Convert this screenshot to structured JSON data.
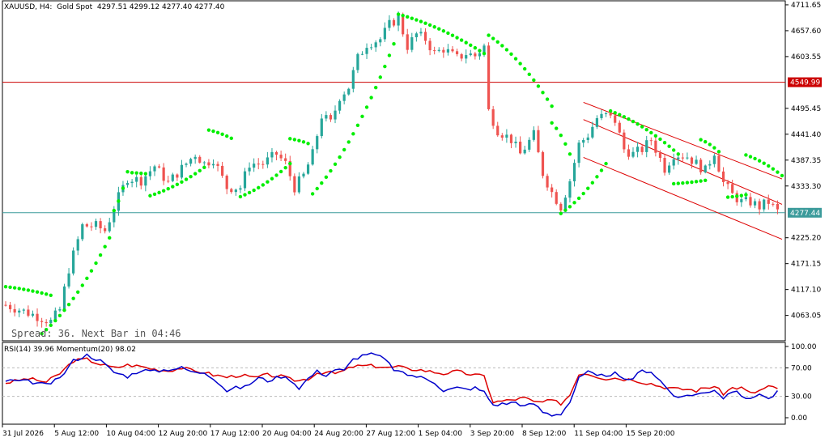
{
  "symbol_header": "XAUUSD, H4:  Gold Spot  4297.51 4299.12 4277.40 4277.40",
  "spread_text": "Spread: 36. Next Bar in 04:46",
  "indicator_header": "RSI(14) 39.96 Momentum(20) 98.02",
  "colors": {
    "bull": "#26a69a",
    "bear": "#ef5350",
    "sar": "#00ee00",
    "hline_red": "#cc0000",
    "hline_teal": "#3b9b9b",
    "rsi": "#0000cc",
    "momentum": "#dd0000",
    "channel": "#dd0000"
  },
  "chart_data": [
    {
      "type": "candlestick",
      "symbol": "XAUUSD",
      "timeframe": "H4",
      "ohlc_last": {
        "open": 4297.51,
        "high": 4299.12,
        "low": 4277.4,
        "close": 4277.4
      },
      "ylim": [
        4010,
        4720
      ],
      "price_ticks": [
        "4711.65",
        "4657.60",
        "4603.55",
        "4495.45",
        "4441.40",
        "4387.35",
        "4333.30",
        "4225.20",
        "4171.15",
        "4117.10",
        "4063.05"
      ],
      "horizontal_lines": [
        {
          "label": "4549.99",
          "value": 4549.99,
          "color": "#cc0000"
        },
        {
          "label": "4277.44",
          "value": 4277.44,
          "color": "#3b9b9b"
        }
      ],
      "time_labels": [
        "31 Jul 2026",
        "5 Aug 12:00",
        "10 Aug 04:00",
        "12 Aug 20:00",
        "17 Aug 12:00",
        "20 Aug 04:00",
        "24 Aug 20:00",
        "27 Aug 12:00",
        "1 Sep 04:00",
        "3 Sep 20:00",
        "8 Sep 12:00",
        "11 Sep 04:00",
        "15 Sep 20:00"
      ],
      "close_path": [
        [
          0,
          4085
        ],
        [
          6,
          4065
        ],
        [
          10,
          4050
        ],
        [
          12,
          4075
        ],
        [
          14,
          4160
        ],
        [
          17,
          4250
        ],
        [
          20,
          4250
        ],
        [
          22,
          4240
        ],
        [
          25,
          4310
        ],
        [
          27,
          4350
        ],
        [
          30,
          4345
        ],
        [
          33,
          4375
        ],
        [
          36,
          4340
        ],
        [
          39,
          4370
        ],
        [
          42,
          4400
        ],
        [
          44,
          4380
        ],
        [
          46,
          4390
        ],
        [
          49,
          4330
        ],
        [
          52,
          4330
        ],
        [
          54,
          4380
        ],
        [
          57,
          4380
        ],
        [
          60,
          4400
        ],
        [
          62,
          4380
        ],
        [
          64,
          4330
        ],
        [
          66,
          4355
        ],
        [
          68,
          4400
        ],
        [
          70,
          4480
        ],
        [
          72,
          4465
        ],
        [
          74,
          4520
        ],
        [
          76,
          4540
        ],
        [
          78,
          4600
        ],
        [
          80,
          4630
        ],
        [
          83,
          4640
        ],
        [
          85,
          4670
        ],
        [
          87,
          4685
        ],
        [
          89,
          4625
        ],
        [
          91,
          4650
        ],
        [
          93,
          4640
        ],
        [
          95,
          4610
        ],
        [
          97,
          4620
        ],
        [
          100,
          4600
        ],
        [
          102,
          4610
        ],
        [
          104,
          4605
        ],
        [
          106,
          4625
        ],
        [
          107,
          4490
        ],
        [
          109,
          4450
        ],
        [
          112,
          4430
        ],
        [
          114,
          4400
        ],
        [
          117,
          4440
        ],
        [
          119,
          4360
        ],
        [
          121,
          4320
        ],
        [
          123,
          4290
        ],
        [
          125,
          4345
        ],
        [
          127,
          4420
        ],
        [
          129,
          4440
        ],
        [
          131,
          4475
        ],
        [
          133,
          4480
        ],
        [
          135,
          4470
        ],
        [
          137,
          4410
        ],
        [
          139,
          4400
        ],
        [
          141,
          4410
        ],
        [
          143,
          4430
        ],
        [
          146,
          4370
        ],
        [
          148,
          4400
        ],
        [
          151,
          4395
        ],
        [
          153,
          4380
        ],
        [
          155,
          4365
        ],
        [
          157,
          4405
        ],
        [
          159,
          4340
        ],
        [
          161,
          4315
        ],
        [
          163,
          4300
        ],
        [
          165,
          4300
        ],
        [
          167,
          4290
        ],
        [
          169,
          4300
        ],
        [
          171,
          4280
        ]
      ],
      "parabolic_sar": [
        {
          "from": [
            0,
            4123
          ],
          "to": [
            10,
            4105
          ]
        },
        {
          "from": [
            8,
            4025
          ],
          "to": [
            23,
            4225
          ]
        },
        {
          "from": [
            24,
            4282
          ],
          "to": [
            27,
            4363
          ]
        },
        {
          "from": [
            28,
            4361
          ],
          "to": [
            31,
            4359
          ]
        },
        {
          "from": [
            32,
            4313
          ],
          "to": [
            44,
            4372
          ]
        },
        {
          "from": [
            45,
            4450
          ],
          "to": [
            50,
            4433
          ]
        },
        {
          "from": [
            52,
            4311
          ],
          "to": [
            63,
            4380
          ]
        },
        {
          "from": [
            63,
            4432
          ],
          "to": [
            67,
            4422
          ]
        },
        {
          "from": [
            68,
            4317
          ],
          "to": [
            86,
            4630
          ]
        },
        {
          "from": [
            87,
            4692
          ],
          "to": [
            106,
            4610
          ]
        },
        {
          "from": [
            107,
            4648
          ],
          "to": [
            121,
            4500
          ]
        },
        {
          "from": [
            121,
            4465
          ],
          "to": [
            125,
            4400
          ]
        },
        {
          "from": [
            123,
            4276
          ],
          "to": [
            133,
            4380
          ]
        },
        {
          "from": [
            134,
            4490
          ],
          "to": [
            149,
            4400
          ]
        },
        {
          "from": [
            148,
            4338
          ],
          "to": [
            155,
            4345
          ]
        },
        {
          "from": [
            154,
            4430
          ],
          "to": [
            158,
            4405
          ]
        },
        {
          "from": [
            160,
            4310
          ],
          "to": [
            164,
            4315
          ]
        },
        {
          "from": [
            164,
            4398
          ],
          "to": [
            172,
            4355
          ]
        }
      ],
      "channel_lines": [
        {
          "from": [
            128,
            4508
          ],
          "to": [
            172,
            4348
          ]
        },
        {
          "from": [
            128,
            4472
          ],
          "to": [
            172,
            4295
          ]
        },
        {
          "from": [
            128,
            4393
          ],
          "to": [
            172,
            4222
          ]
        }
      ]
    },
    {
      "type": "line",
      "title": "RSI(14) 39.96 Momentum(20) 98.02",
      "ylim": [
        0,
        100
      ],
      "y_ticks": [
        "100.00",
        "70.00",
        "30.00",
        "0.00"
      ],
      "levels": [
        70,
        30
      ],
      "series": [
        {
          "name": "RSI(14)",
          "color": "#0000cc",
          "last": 39.96,
          "values": [
            [
              0,
              52
            ],
            [
              5,
              51
            ],
            [
              9,
              46
            ],
            [
              12,
              55
            ],
            [
              15,
              80
            ],
            [
              18,
              88
            ],
            [
              21,
              80
            ],
            [
              24,
              64
            ],
            [
              27,
              58
            ],
            [
              30,
              67
            ],
            [
              33,
              65
            ],
            [
              36,
              68
            ],
            [
              39,
              70
            ],
            [
              42,
              63
            ],
            [
              44,
              64
            ],
            [
              46,
              56
            ],
            [
              49,
              38
            ],
            [
              51,
              42
            ],
            [
              53,
              43
            ],
            [
              56,
              56
            ],
            [
              58,
              52
            ],
            [
              61,
              58
            ],
            [
              63,
              54
            ],
            [
              65,
              42
            ],
            [
              67,
              55
            ],
            [
              69,
              65
            ],
            [
              71,
              60
            ],
            [
              73,
              68
            ],
            [
              75,
              66
            ],
            [
              77,
              82
            ],
            [
              80,
              90
            ],
            [
              82,
              88
            ],
            [
              84,
              82
            ],
            [
              86,
              68
            ],
            [
              88,
              62
            ],
            [
              91,
              58
            ],
            [
              93,
              55
            ],
            [
              95,
              50
            ],
            [
              97,
              38
            ],
            [
              100,
              42
            ],
            [
              102,
              40
            ],
            [
              104,
              42
            ],
            [
              106,
              36
            ],
            [
              108,
              18
            ],
            [
              111,
              20
            ],
            [
              113,
              22
            ],
            [
              115,
              16
            ],
            [
              117,
              20
            ],
            [
              119,
              8
            ],
            [
              121,
              4
            ],
            [
              123,
              6
            ],
            [
              125,
              22
            ],
            [
              127,
              55
            ],
            [
              129,
              64
            ],
            [
              131,
              58
            ],
            [
              133,
              60
            ],
            [
              135,
              62
            ],
            [
              137,
              52
            ],
            [
              139,
              56
            ],
            [
              141,
              66
            ],
            [
              143,
              65
            ],
            [
              145,
              52
            ],
            [
              147,
              38
            ],
            [
              149,
              26
            ],
            [
              151,
              32
            ],
            [
              153,
              33
            ],
            [
              155,
              35
            ],
            [
              157,
              40
            ],
            [
              159,
              28
            ],
            [
              161,
              38
            ],
            [
              163,
              32
            ],
            [
              165,
              25
            ],
            [
              167,
              35
            ],
            [
              169,
              26
            ],
            [
              171,
              36
            ]
          ]
        },
        {
          "name": "Momentum(20)",
          "color": "#dd0000",
          "last": 98.02,
          "values": [
            [
              0,
              49
            ],
            [
              5,
              55
            ],
            [
              9,
              50
            ],
            [
              12,
              62
            ],
            [
              15,
              80
            ],
            [
              18,
              82
            ],
            [
              21,
              75
            ],
            [
              24,
              70
            ],
            [
              27,
              74
            ],
            [
              30,
              72
            ],
            [
              33,
              68
            ],
            [
              36,
              66
            ],
            [
              39,
              70
            ],
            [
              42,
              65
            ],
            [
              44,
              64
            ],
            [
              46,
              60
            ],
            [
              49,
              57
            ],
            [
              52,
              60
            ],
            [
              55,
              56
            ],
            [
              58,
              60
            ],
            [
              61,
              58
            ],
            [
              63,
              54
            ],
            [
              65,
              52
            ],
            [
              67,
              55
            ],
            [
              69,
              63
            ],
            [
              71,
              64
            ],
            [
              73,
              62
            ],
            [
              75,
              66
            ],
            [
              77,
              72
            ],
            [
              80,
              73
            ],
            [
              83,
              72
            ],
            [
              85,
              70
            ],
            [
              87,
              72
            ],
            [
              89,
              68
            ],
            [
              91,
              68
            ],
            [
              93,
              66
            ],
            [
              95,
              64
            ],
            [
              97,
              62
            ],
            [
              100,
              65
            ],
            [
              102,
              62
            ],
            [
              104,
              60
            ],
            [
              106,
              58
            ],
            [
              108,
              22
            ],
            [
              111,
              24
            ],
            [
              113,
              26
            ],
            [
              115,
              28
            ],
            [
              117,
              22
            ],
            [
              119,
              22
            ],
            [
              121,
              24
            ],
            [
              123,
              20
            ],
            [
              125,
              32
            ],
            [
              127,
              62
            ],
            [
              129,
              62
            ],
            [
              131,
              58
            ],
            [
              133,
              55
            ],
            [
              135,
              56
            ],
            [
              137,
              54
            ],
            [
              139,
              54
            ],
            [
              141,
              50
            ],
            [
              143,
              48
            ],
            [
              145,
              44
            ],
            [
              147,
              42
            ],
            [
              149,
              40
            ],
            [
              151,
              40
            ],
            [
              153,
              38
            ],
            [
              155,
              42
            ],
            [
              157,
              44
            ],
            [
              159,
              34
            ],
            [
              161,
              42
            ],
            [
              163,
              42
            ],
            [
              165,
              34
            ],
            [
              167,
              38
            ],
            [
              169,
              44
            ],
            [
              171,
              40
            ]
          ]
        }
      ]
    }
  ]
}
